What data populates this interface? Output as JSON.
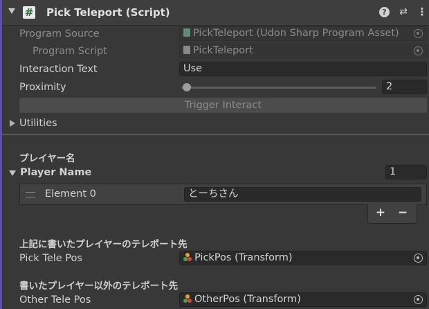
{
  "header": {
    "title": "Pick Teleport (Script)",
    "script_icon_glyph": "#",
    "icons": [
      "help-icon",
      "presets-icon",
      "context-menu-icon"
    ]
  },
  "fields": {
    "program_source": {
      "label": "Program Source",
      "value": "PickTeleport (Udon Sharp Program Asset)"
    },
    "program_script": {
      "label": "Program Script",
      "value": "PickTeleport"
    },
    "interaction_text": {
      "label": "Interaction Text",
      "value": "Use"
    },
    "proximity": {
      "label": "Proximity",
      "value": "2",
      "slider_fraction": 0.02
    },
    "trigger_button": "Trigger Interact",
    "utilities": "Utilities"
  },
  "player_section": {
    "header": "プレイヤー名",
    "list_label": "Player Name",
    "size": "1",
    "elements": [
      {
        "label": "Element 0",
        "value": "とーちさん"
      }
    ],
    "add": "+",
    "remove": "−"
  },
  "pick_section": {
    "header": "上記に書いたプレイヤーのテレポート先",
    "label": "Pick Tele Pos",
    "value": "PickPos (Transform)"
  },
  "other_section": {
    "header": "書いたプレイヤー以外のテレポート先",
    "label": "Other Tele Pos",
    "value": "OtherPos (Transform)"
  },
  "colors": {
    "accent": "#5d4fa8",
    "background": "#383838",
    "field": "#2a2a2a"
  }
}
